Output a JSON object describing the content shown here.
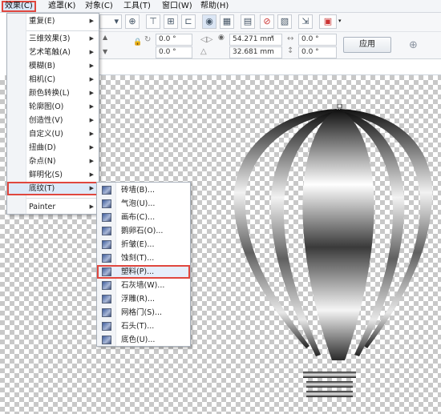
{
  "menubar": {
    "items": [
      "效果(C)",
      "遮罩(K)",
      "对象(C)",
      "工具(T)",
      "窗口(W)",
      "帮助(H)"
    ]
  },
  "toolbar": {
    "angle_1": "0.0 °",
    "angle_2": "0.0 °",
    "width_value": "54.271 mm",
    "height_value": "32.681 mm",
    "x_value": "0.0 °",
    "y_value": "0.0 °",
    "apply_label": "应用"
  },
  "effects_menu": {
    "items": [
      {
        "label": "重复(E)"
      },
      {
        "label": "三维效果(3)"
      },
      {
        "label": "艺术笔触(A)"
      },
      {
        "label": "模糊(B)"
      },
      {
        "label": "相机(C)"
      },
      {
        "label": "颜色转换(L)"
      },
      {
        "label": "轮廓图(O)"
      },
      {
        "label": "创造性(V)"
      },
      {
        "label": "自定义(U)"
      },
      {
        "label": "扭曲(D)"
      },
      {
        "label": "杂点(N)"
      },
      {
        "label": "鲜明化(S)"
      },
      {
        "label": "底纹(T)"
      },
      {
        "label": "Painter"
      }
    ]
  },
  "texture_submenu": {
    "items": [
      {
        "label": "砖墙(B)..."
      },
      {
        "label": "气泡(U)..."
      },
      {
        "label": "画布(C)..."
      },
      {
        "label": "鹅卵石(O)..."
      },
      {
        "label": "折皱(E)..."
      },
      {
        "label": "蚀刻(T)..."
      },
      {
        "label": "塑料(P)..."
      },
      {
        "label": "石灰墙(W)..."
      },
      {
        "label": "浮雕(R)..."
      },
      {
        "label": "网格门(S)..."
      },
      {
        "label": "石头(T)..."
      },
      {
        "label": "底色(U)..."
      }
    ]
  }
}
